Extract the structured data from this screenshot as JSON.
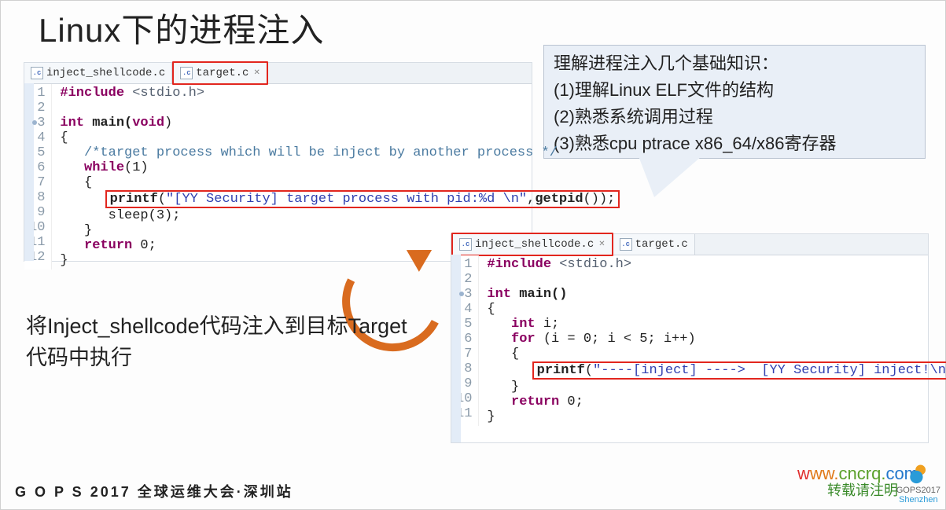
{
  "title": "Linux下的进程注入",
  "callout": {
    "l1": "理解进程注入几个基础知识：",
    "l2": "(1)理解Linux ELF文件的结构",
    "l3": "(2)熟悉系统调用过程",
    "l4": "(3)熟悉cpu ptrace x86_64/x86寄存器"
  },
  "editor1": {
    "tab1": "inject_shellcode.c",
    "tab2": "target.c",
    "ln": [
      "1",
      "2",
      "3",
      "4",
      "5",
      "6",
      "7",
      "8",
      "9",
      "10",
      "11",
      "12"
    ],
    "code": {
      "l1a": "#include",
      "l1b": " <stdio.h>",
      "l2": "",
      "l3a": "int",
      "l3b": " main(",
      "l3c": "void",
      "l3d": ")",
      "l4": "{",
      "l5": "   /*target process which will be inject by another process */",
      "l6a": "   while",
      "l6b": "(1)",
      "l7": "   {",
      "l8a": "      ",
      "l8fn": "printf",
      "l8b": "(",
      "l8s": "\"[YY Security] target process with pid:%d \\n\"",
      "l8c": ",",
      "l8fn2": "getpid",
      "l8d": "());",
      "l9": "      sleep(3);",
      "l10": "   }",
      "l11a": "   return",
      "l11b": " 0;",
      "l12": "}"
    }
  },
  "editor2": {
    "tab1": "inject_shellcode.c",
    "tab2": "target.c",
    "ln": [
      "1",
      "2",
      "3",
      "4",
      "5",
      "6",
      "7",
      "8",
      "9",
      "10",
      "11"
    ],
    "code": {
      "l1a": "#include",
      "l1b": " <stdio.h>",
      "l2": "",
      "l3a": "int",
      "l3b": " main()",
      "l4": "{",
      "l5a": "   int",
      "l5b": " i;",
      "l6a": "   for",
      "l6b": " (i = 0; i < 5; i++)",
      "l7": "   {",
      "l8a": "      ",
      "l8fn": "printf",
      "l8b": "(",
      "l8s": "\"----[inject] ---->  [YY Security] inject!\\n\"",
      "l8c": ");",
      "l9": "   }",
      "l10a": "   return",
      "l10b": " 0;",
      "l11": "}"
    }
  },
  "annotation": {
    "l1": "将Inject_shellcode代码注入到目标Target",
    "l2": "代码中执行"
  },
  "footer": "G O P S 2017 全球运维大会·深圳站",
  "watermark": {
    "w1": "w",
    "w2": "ww.",
    "w3": "cncrq.",
    "w4": "com"
  },
  "watermark2": "转载请注明",
  "logo": {
    "t1": "GOPS2017",
    "t2": "Shenzhen"
  }
}
